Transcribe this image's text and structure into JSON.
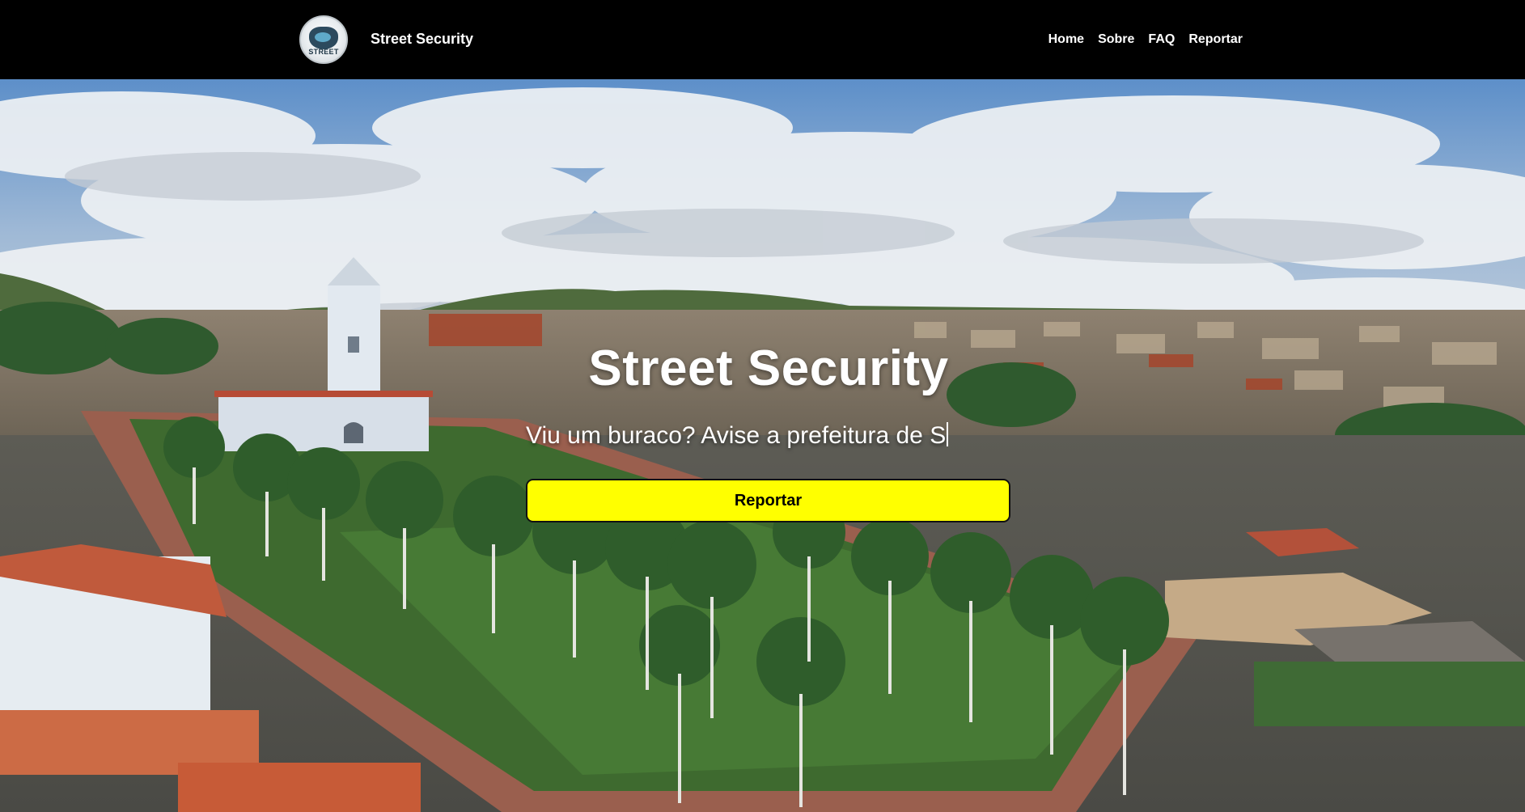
{
  "navbar": {
    "logo_text": "STREET",
    "brand": "Street Security",
    "links": [
      "Home",
      "Sobre",
      "FAQ",
      "Reportar"
    ]
  },
  "hero": {
    "title": "Street Security",
    "typed_text": "Viu um buraco? Avise a prefeitura de S",
    "cta_label": "Reportar",
    "background": "aerial view of a small town with white church, palm-lined square and cloudy blue sky"
  },
  "colors": {
    "navbar_bg": "#000000",
    "cta_bg": "#ffff00",
    "text": "#ffffff"
  }
}
